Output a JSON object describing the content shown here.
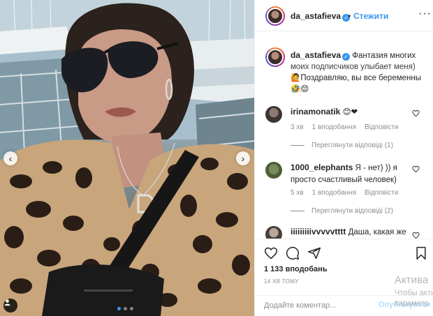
{
  "post": {
    "username": "da_astafieva",
    "follow_label": "Стежити",
    "separator": "•",
    "more_label": "···"
  },
  "caption": {
    "username": "da_astafieva",
    "text_line1": "Фантазия многих",
    "text_line2": "моих подписчиков улыбает меня)",
    "text_line3": "Поздравляю, вы все беременны",
    "emoji_mark": "🤣😊",
    "green_mark": "🙋",
    "time": "14 хв"
  },
  "comments": [
    {
      "username": "irinamonatik",
      "text": "😊❤",
      "time": "3 хв",
      "likes": "1 вподобання",
      "reply_label": "Відповісти",
      "view_replies": "Переглянути відповіді (1)"
    },
    {
      "username": "1000_elephants",
      "text": "Я - нет) )) я просто счастливый человек)",
      "time": "5 хв",
      "likes": "1 вподобання",
      "reply_label": "Відповісти",
      "view_replies": "Переглянути відповіді (2)"
    },
    {
      "username": "iiiiiiiiivvvvvtttt",
      "text": "Даша, какая же"
    }
  ],
  "actions": {
    "likes_count": "1 133 вподобань",
    "posted_time": "14 ХВ ТОМУ",
    "comment_placeholder": "Додайте коментар...",
    "publish_label": "Опублікувати"
  },
  "carousel": {
    "prev_label": "‹",
    "next_label": "›",
    "total_slides": 3,
    "active_slide": 1
  },
  "watermark": {
    "line1": "Актива",
    "line2": "Чтобы акти",
    "line3": "параметр"
  },
  "colors": {
    "accent": "#3897f0",
    "text": "#262626",
    "muted": "#8e8e8e",
    "heart": "#ed4956"
  }
}
